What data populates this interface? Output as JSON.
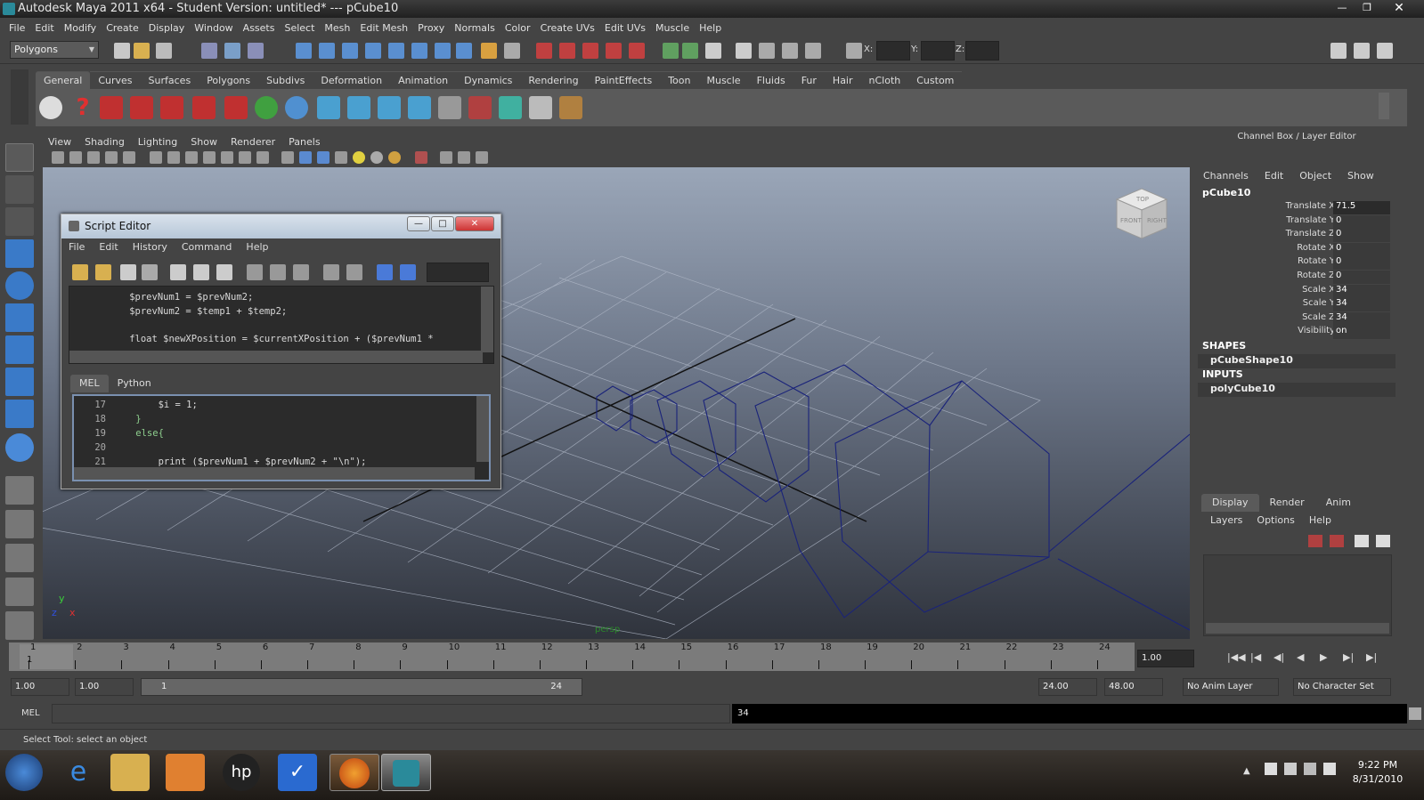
{
  "window": {
    "title": "Autodesk Maya 2011 x64 - Student Version: untitled*   ---   pCube10"
  },
  "menus": [
    "File",
    "Edit",
    "Modify",
    "Create",
    "Display",
    "Window",
    "Assets",
    "Select",
    "Mesh",
    "Edit Mesh",
    "Proxy",
    "Normals",
    "Color",
    "Create UVs",
    "Edit UVs",
    "Muscle",
    "Help"
  ],
  "statusline": {
    "mode": "Polygons",
    "x_label": "X:",
    "y_label": "Y:",
    "z_label": "Z:"
  },
  "shelf_tabs": [
    "General",
    "Curves",
    "Surfaces",
    "Polygons",
    "Subdivs",
    "Deformation",
    "Animation",
    "Dynamics",
    "Rendering",
    "PaintEffects",
    "Toon",
    "Muscle",
    "Fluids",
    "Fur",
    "Hair",
    "nCloth",
    "Custom"
  ],
  "shelf_active": "General",
  "viewport_menu": [
    "View",
    "Shading",
    "Lighting",
    "Show",
    "Renderer",
    "Panels"
  ],
  "viewport": {
    "camera_label": "persp",
    "cube_top": "TOP",
    "cube_front": "FRONT",
    "cube_right": "RIGHT",
    "axis_y": "y",
    "axis_x": "x",
    "axis_z": "z"
  },
  "channelbox": {
    "header": "Channel Box / Layer Editor",
    "menu": [
      "Channels",
      "Edit",
      "Object",
      "Show"
    ],
    "object": "pCube10",
    "channels": [
      {
        "label": "Translate X",
        "value": "71.5"
      },
      {
        "label": "Translate Y",
        "value": "0"
      },
      {
        "label": "Translate Z",
        "value": "0"
      },
      {
        "label": "Rotate X",
        "value": "0"
      },
      {
        "label": "Rotate Y",
        "value": "0"
      },
      {
        "label": "Rotate Z",
        "value": "0"
      },
      {
        "label": "Scale X",
        "value": "34"
      },
      {
        "label": "Scale Y",
        "value": "34"
      },
      {
        "label": "Scale Z",
        "value": "34"
      },
      {
        "label": "Visibility",
        "value": "on"
      }
    ],
    "shapes_header": "SHAPES",
    "shape": "pCubeShape10",
    "inputs_header": "INPUTS",
    "input": "polyCube10"
  },
  "layers": {
    "tabs": [
      "Display",
      "Render",
      "Anim"
    ],
    "menu": [
      "Layers",
      "Options",
      "Help"
    ]
  },
  "timeslider": {
    "frames": [
      "1",
      "2",
      "3",
      "4",
      "5",
      "6",
      "7",
      "8",
      "9",
      "10",
      "11",
      "12",
      "13",
      "14",
      "15",
      "16",
      "17",
      "18",
      "19",
      "20",
      "21",
      "22",
      "23",
      "24"
    ],
    "current": "1",
    "current_field": "1.00"
  },
  "range": {
    "start": "1.00",
    "start2": "1.00",
    "min": "1",
    "max": "24",
    "end": "24.00",
    "end2": "48.00",
    "anim_layer": "No Anim Layer",
    "char_set": "No Character Set"
  },
  "cmdline": {
    "label": "MEL",
    "result": "34"
  },
  "helpline": "Select Tool: select an object",
  "taskbar": {
    "time": "9:22 PM",
    "date": "8/31/2010"
  },
  "script_editor": {
    "title": "Script Editor",
    "menu": [
      "File",
      "Edit",
      "History",
      "Command",
      "Help"
    ],
    "history_lines": [
      "          $prevNum1 = $prevNum2;",
      "          $prevNum2 = $temp1 + $temp2;",
      "",
      "          float $newXPosition = $currentXPosition + ($prevNum1 *",
      "          ..."
    ],
    "tabs": [
      "MEL",
      "Python"
    ],
    "input_lines": [
      {
        "n": "17",
        "code": "        $i = 1;"
      },
      {
        "n": "18",
        "code": "    }"
      },
      {
        "n": "19",
        "code": "    else{"
      },
      {
        "n": "20",
        "code": ""
      },
      {
        "n": "21",
        "code": "        print ($prevNum1 + $prevNum2 + \"\\n\");"
      }
    ]
  }
}
